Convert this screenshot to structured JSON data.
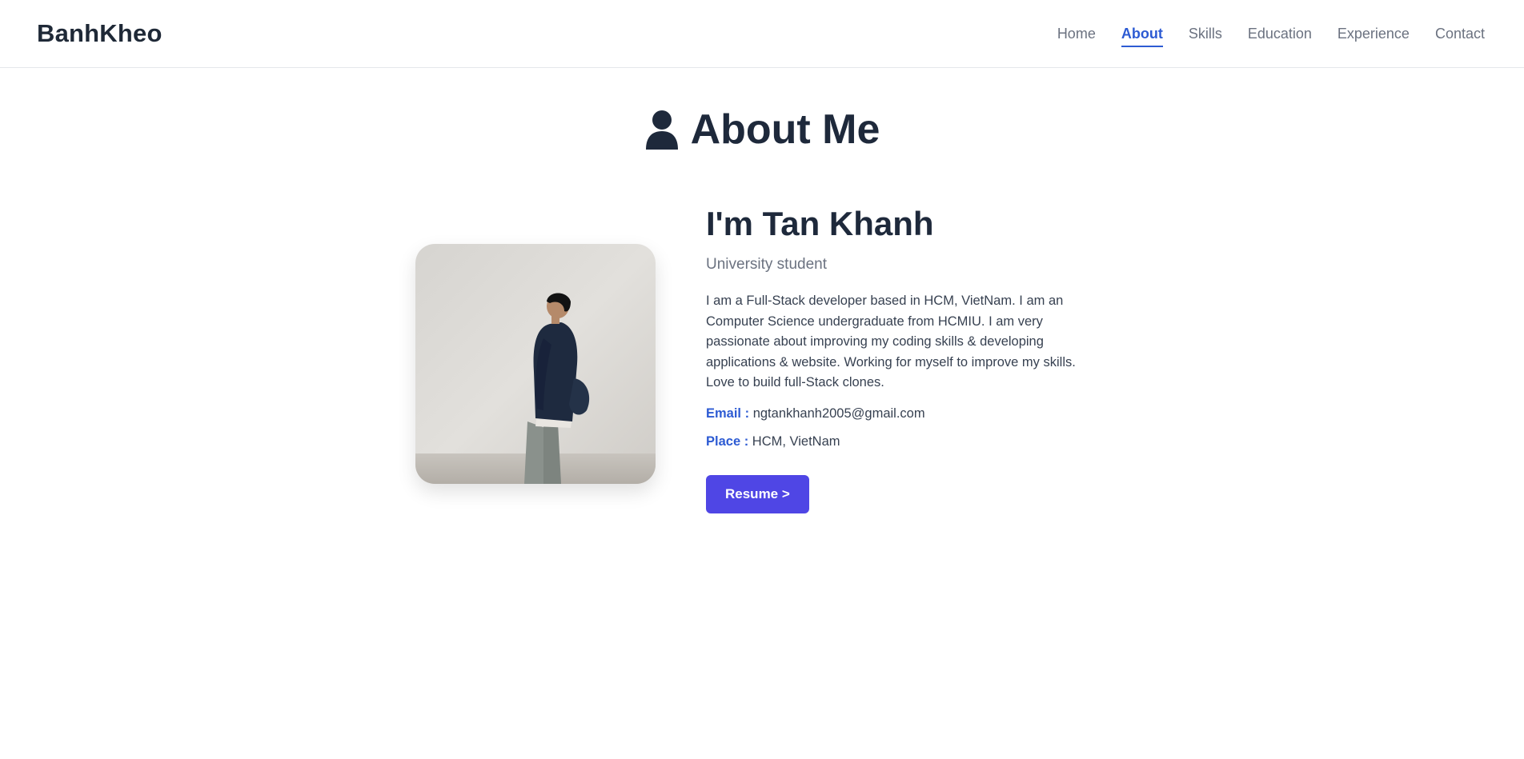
{
  "header": {
    "brand": "BanhKheo",
    "nav": [
      {
        "label": "Home",
        "active": false
      },
      {
        "label": "About",
        "active": true
      },
      {
        "label": "Skills",
        "active": false
      },
      {
        "label": "Education",
        "active": false
      },
      {
        "label": "Experience",
        "active": false
      },
      {
        "label": "Contact",
        "active": false
      }
    ]
  },
  "section": {
    "title": "About Me",
    "icon": "user-icon"
  },
  "profile": {
    "greeting": "I'm Tan Khanh",
    "role": "University student",
    "bio": "I am a Full-Stack developer based in HCM, VietNam. I am an Computer Science undergraduate from HCMIU. I am very passionate about improving my coding skills & developing applications & website. Working for myself to improve my skills. Love to build full-Stack clones.",
    "email_label": "Email :",
    "email": "ngtankhanh2005@gmail.com",
    "place_label": "Place :",
    "place": "HCM, VietNam",
    "resume_label": "Resume >"
  },
  "colors": {
    "accent": "#2d5bd3",
    "button": "#4f46e5",
    "heading": "#1e293b"
  }
}
